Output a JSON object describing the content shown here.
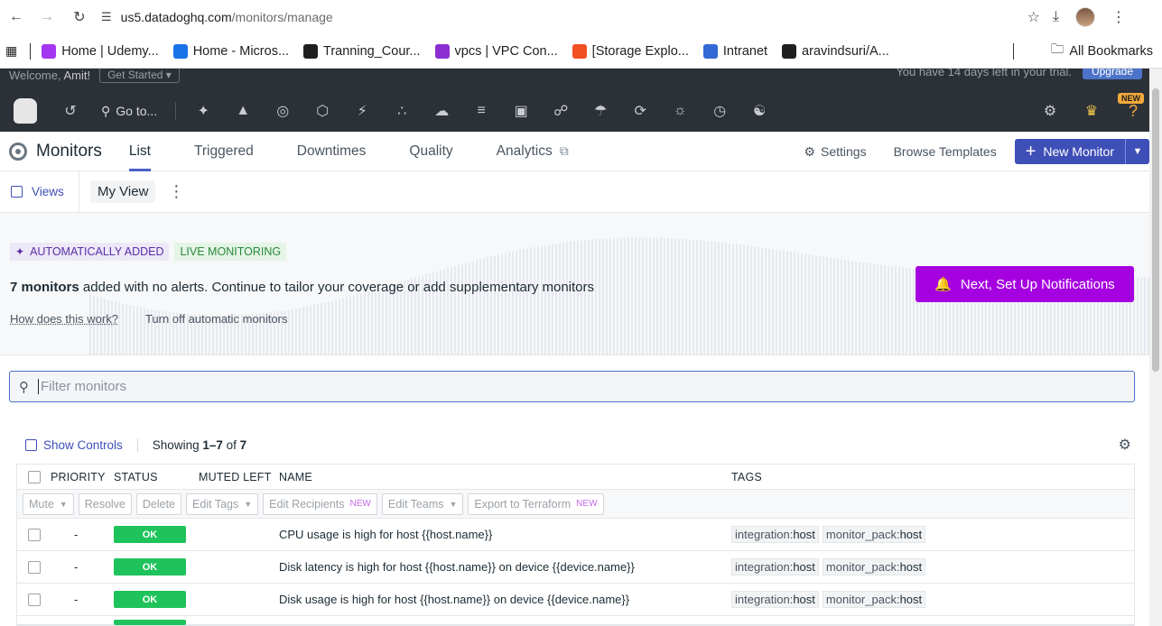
{
  "browser": {
    "url_host": "us5.datadoghq.com",
    "url_path": "/monitors/manage",
    "bookmarks": [
      {
        "label": "Home | Udemy...",
        "color": "#a435f0"
      },
      {
        "label": "Home - Micros...",
        "color": "#1a73e8"
      },
      {
        "label": "Tranning_Cour...",
        "color": "#1f1f1f"
      },
      {
        "label": "vpcs | VPC Con...",
        "color": "#8c2fd0"
      },
      {
        "label": "[Storage Explo...",
        "color": "#f25022"
      },
      {
        "label": "Intranet",
        "color": "#3367d6"
      },
      {
        "label": "aravindsuri/A...",
        "color": "#1f1f1f"
      }
    ],
    "all_bookmarks": "All Bookmarks"
  },
  "trial": {
    "welcome": "Welcome, ",
    "user": "Amit!",
    "get_started": "Get Started",
    "trial_text": "You have 14 days left in your trial.",
    "upgrade": "Upgrade"
  },
  "topnav": {
    "goto": "Go to...",
    "new_badge": "NEW"
  },
  "header": {
    "title": "Monitors",
    "tabs": [
      "List",
      "Triggered",
      "Downtimes",
      "Quality",
      "Analytics"
    ],
    "settings": "Settings",
    "browse_templates": "Browse Templates",
    "new_monitor": "New Monitor"
  },
  "views": {
    "views_label": "Views",
    "current_view": "My View"
  },
  "banner": {
    "badge_auto": "AUTOMATICALLY ADDED",
    "badge_live": "LIVE MONITORING",
    "count_text": "7 monitors",
    "rest_text": " added with no alerts. Continue to tailor your coverage or add supplementary monitors",
    "how_link": "How does this work?",
    "turn_off": "Turn off automatic monitors",
    "notify_button": "Next, Set Up Notifications"
  },
  "filter": {
    "placeholder": "Filter monitors"
  },
  "controls": {
    "show_controls": "Show Controls",
    "showing_prefix": "Showing ",
    "showing_range": "1–7",
    "showing_of": " of ",
    "showing_total": "7"
  },
  "table": {
    "columns": [
      "PRIORITY",
      "STATUS",
      "MUTED LEFT",
      "NAME",
      "TAGS"
    ],
    "bulk_actions": {
      "mute": "Mute",
      "resolve": "Resolve",
      "delete": "Delete",
      "edit_tags": "Edit Tags",
      "edit_recipients": "Edit Recipients",
      "edit_teams": "Edit Teams",
      "export": "Export to Terraform",
      "new_label": "NEW"
    },
    "rows": [
      {
        "priority": "-",
        "status": "OK",
        "name": "CPU usage is high for host {{host.name}}",
        "tag1_key": "integration:",
        "tag1_val": "host",
        "tag2_key": "monitor_pack:",
        "tag2_val": "host"
      },
      {
        "priority": "-",
        "status": "OK",
        "name": "Disk latency is high for host {{host.name}} on device {{device.name}}",
        "tag1_key": "integration:",
        "tag1_val": "host",
        "tag2_key": "monitor_pack:",
        "tag2_val": "host"
      },
      {
        "priority": "-",
        "status": "OK",
        "name": "Disk usage is high for host {{host.name}} on device {{device.name}}",
        "tag1_key": "integration:",
        "tag1_val": "host",
        "tag2_key": "monitor_pack:",
        "tag2_val": "host"
      }
    ]
  }
}
